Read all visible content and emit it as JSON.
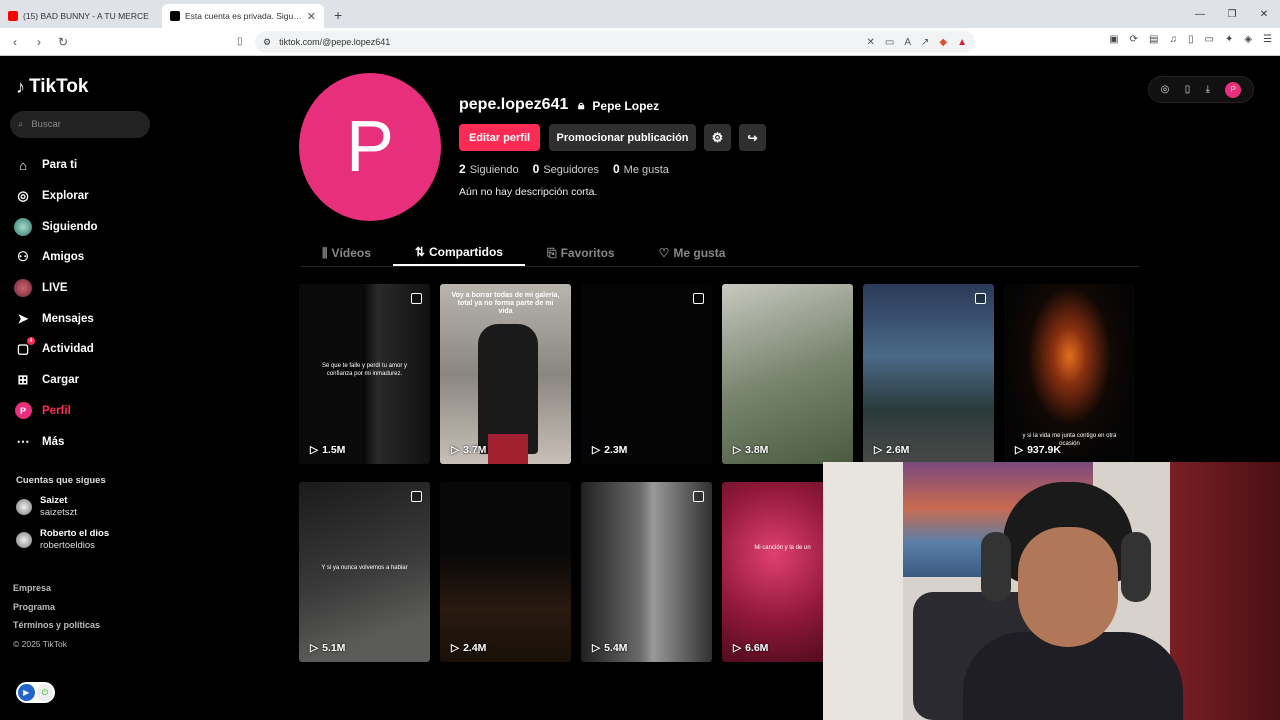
{
  "browser": {
    "tabs": [
      {
        "title": "(15) BAD BUNNY - A TU MERCE"
      },
      {
        "title": "Esta cuenta es privada. Sigue est"
      }
    ],
    "url": "tiktok.com/@pepe.lopez641"
  },
  "sidebar": {
    "logo": "TikTok",
    "search_placeholder": "Buscar",
    "items": [
      {
        "label": "Para ti",
        "icon": "home-icon"
      },
      {
        "label": "Explorar",
        "icon": "compass-icon"
      },
      {
        "label": "Siguiendo",
        "icon": "following-avatar-icon"
      },
      {
        "label": "Amigos",
        "icon": "friends-icon"
      },
      {
        "label": "LIVE",
        "icon": "live-icon"
      },
      {
        "label": "Mensajes",
        "icon": "send-icon"
      },
      {
        "label": "Actividad",
        "icon": "activity-icon",
        "badge": "4"
      },
      {
        "label": "Cargar",
        "icon": "upload-icon"
      },
      {
        "label": "Perfil",
        "icon": "profile-icon"
      },
      {
        "label": "Más",
        "icon": "more-icon"
      }
    ],
    "following_title": "Cuentas que sigues",
    "accounts": [
      {
        "name": "Saizet",
        "handle": "saizetszt"
      },
      {
        "name": "Roberto el dios",
        "handle": "robertoeldios"
      }
    ],
    "footer": [
      "Empresa",
      "Programa",
      "Términos y políticas",
      "© 2025 TikTok"
    ]
  },
  "profile": {
    "avatar_letter": "P",
    "username": "pepe.lopez641",
    "nickname": "Pepe Lopez",
    "edit_label": "Editar perfil",
    "promote_label": "Promocionar publicación",
    "stats": [
      {
        "value": "2",
        "label": "Siguiendo"
      },
      {
        "value": "0",
        "label": "Seguidores"
      },
      {
        "value": "0",
        "label": "Me gusta"
      }
    ],
    "bio": "Aún no hay descripción corta.",
    "tabs": [
      "Vídeos",
      "Compartidos",
      "Favoritos",
      "Me gusta"
    ],
    "active_tab": "Compartidos"
  },
  "videos": [
    {
      "views": "1.5M",
      "caption": "Sé que te falle y perdí tu amor y confianza por mi inmadurez."
    },
    {
      "views": "3.7M",
      "caption": "Voy a borrar todas de mi galería, total ya no forma parte de mi vida"
    },
    {
      "views": "2.3M",
      "caption": ""
    },
    {
      "views": "3.8M",
      "caption": ""
    },
    {
      "views": "2.6M",
      "caption": ""
    },
    {
      "views": "937.9K",
      "caption": "y si la vida me junta contigo en otra ocasión"
    },
    {
      "views": "5.1M",
      "caption": "Y si ya nunca volvemos a hablar"
    },
    {
      "views": "2.4M",
      "caption": ""
    },
    {
      "views": "5.4M",
      "caption": ""
    },
    {
      "views": "6.6M",
      "caption": "Mi canción y la de un"
    }
  ]
}
